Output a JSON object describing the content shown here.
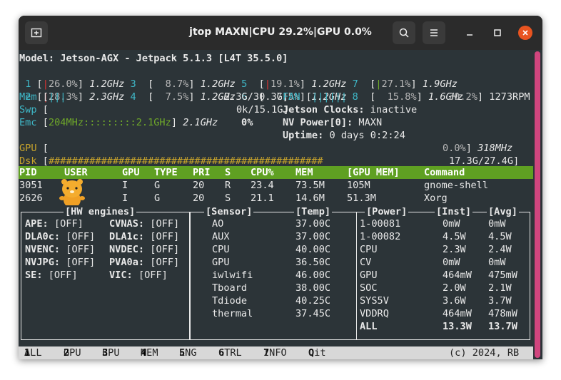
{
  "window": {
    "title": "jtop MAXN|CPU 29.2%|GPU 0.0%"
  },
  "model_line": "Model: Jetson-AGX - Jetpack 5.1.3 [L4T 35.5.0]",
  "cpus": [
    {
      "id": "1",
      "bar": "|",
      "pct": "26.0%",
      "freq": "1.2GHz"
    },
    {
      "id": "3",
      "bar": "",
      "pct": "8.7%",
      "freq": "1.2GHz"
    },
    {
      "id": "5",
      "bar": "|",
      "pct": "19.1%",
      "freq": "1.2GHz"
    },
    {
      "id": "7",
      "bar": "|",
      "pct": "27.1%",
      "freq": "1.9GHz"
    },
    {
      "id": "2",
      "bar": "|",
      "pct": "28.3%",
      "freq": "2.3GHz"
    },
    {
      "id": "4",
      "bar": "",
      "pct": "7.5%",
      "freq": "1.2GHz"
    },
    {
      "id": "6",
      "bar": "",
      "pct": "7.5%",
      "freq": "1.2GHz"
    },
    {
      "id": "8",
      "bar": "",
      "pct": "15.8%",
      "freq": "1.6GHz"
    }
  ],
  "mem": {
    "label": "Mem",
    "bar": "|||",
    "value": "2.3G/30.3G"
  },
  "swp": {
    "label": "Swp",
    "value": "0k/15.1G"
  },
  "emc": {
    "label": "Emc",
    "bar": "204MHz:::::::::2.1GHz",
    "freq": "2.1GHz",
    "pct": "0%"
  },
  "fan": {
    "label": "FAN",
    "bar": "||||||",
    "pct": "30.2%",
    "rpm": "1273RPM"
  },
  "clocks": {
    "label": "Jetson Clocks:",
    "value": "inactive"
  },
  "nvpower": {
    "label": "NV Power[0]:",
    "value": "MAXN"
  },
  "uptime": {
    "label": "Uptime:",
    "value": "0 days 0:2:24"
  },
  "gpu": {
    "label": "GPU",
    "pct": "0.0%",
    "freq": "318MHz"
  },
  "dsk": {
    "label": "Dsk",
    "bar": "###############################################",
    "value": "17.3G/27.4G"
  },
  "proc_headers": [
    "PID",
    "USER",
    "GPU",
    "TYPE",
    "PRI",
    "S",
    "CPU%",
    "MEM",
    "[GPU MEM]",
    "Command"
  ],
  "processes": [
    [
      "3051",
      "",
      "I",
      "G",
      "20",
      "R",
      "23.4",
      "73.5M",
      "105M",
      "gnome-shell"
    ],
    [
      "2626",
      "",
      "I",
      "G",
      "20",
      "S",
      "21.1",
      "14.6M",
      "51.3M",
      "Xorg"
    ]
  ],
  "hw_engines": {
    "title": "[HW engines]",
    "rows": [
      [
        "APE:",
        "[OFF]",
        "CVNAS:",
        "[OFF]"
      ],
      [
        "DLA0c:",
        "[OFF]",
        "DLA1c:",
        "[OFF]"
      ],
      [
        "NVENC:",
        "[OFF]",
        "NVDEC:",
        "[OFF]"
      ],
      [
        "NVJPG:",
        "[OFF]",
        "PVA0a:",
        "[OFF]"
      ],
      [
        "SE:",
        "[OFF]",
        "VIC:",
        "[OFF]"
      ]
    ]
  },
  "sensors": {
    "title_sensor": "[Sensor]",
    "title_temp": "[Temp]",
    "rows": [
      [
        "AO",
        "37.00C"
      ],
      [
        "AUX",
        "37.00C"
      ],
      [
        "CPU",
        "40.00C"
      ],
      [
        "GPU",
        "36.50C"
      ],
      [
        "iwlwifi",
        "46.00C"
      ],
      [
        "Tboard",
        "38.00C"
      ],
      [
        "Tdiode",
        "40.25C"
      ],
      [
        "thermal",
        "37.45C"
      ]
    ]
  },
  "power": {
    "title_power": "[Power]",
    "title_inst": "[Inst]",
    "title_avg": "[Avg]",
    "rows": [
      [
        "1-00081",
        "0mW",
        "0mW"
      ],
      [
        "1-00082",
        "4.5W",
        "4.5W"
      ],
      [
        "CPU",
        "2.3W",
        "2.4W"
      ],
      [
        "CV",
        "0mW",
        "0mW"
      ],
      [
        "GPU",
        "464mW",
        "475mW"
      ],
      [
        "SOC",
        "2.0W",
        "2.1W"
      ],
      [
        "SYS5V",
        "3.6W",
        "3.7W"
      ],
      [
        "VDDRQ",
        "464mW",
        "478mW"
      ]
    ],
    "total": [
      "ALL",
      "13.3W",
      "13.7W"
    ]
  },
  "footer": {
    "tabs": [
      {
        "key": "1",
        "label": "ALL"
      },
      {
        "key": "2",
        "label": "GPU"
      },
      {
        "key": "3",
        "label": "CPU"
      },
      {
        "key": "4",
        "label": "MEM"
      },
      {
        "key": "5",
        "label": "ENG"
      },
      {
        "key": "6",
        "label": "CTRL"
      },
      {
        "key": "7",
        "label": "INFO"
      },
      {
        "key": "Q",
        "label": "uit"
      }
    ],
    "copyright": "(c) 2024, RB"
  },
  "colors": {
    "accent_green": "#5fa022",
    "cyan": "#3fb8c8",
    "close_red": "#e95420"
  }
}
